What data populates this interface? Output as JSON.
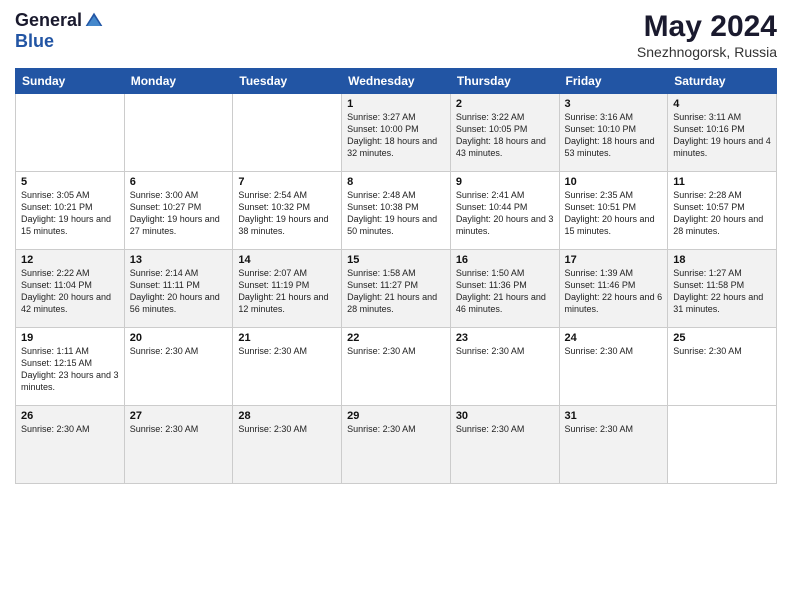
{
  "header": {
    "logo_general": "General",
    "logo_blue": "Blue",
    "month_year": "May 2024",
    "location": "Snezhnogorsk, Russia"
  },
  "days_of_week": [
    "Sunday",
    "Monday",
    "Tuesday",
    "Wednesday",
    "Thursday",
    "Friday",
    "Saturday"
  ],
  "weeks": [
    [
      {
        "day": "",
        "info": ""
      },
      {
        "day": "",
        "info": ""
      },
      {
        "day": "",
        "info": ""
      },
      {
        "day": "1",
        "info": "Sunrise: 3:27 AM\nSunset: 10:00 PM\nDaylight: 18 hours and 32 minutes."
      },
      {
        "day": "2",
        "info": "Sunrise: 3:22 AM\nSunset: 10:05 PM\nDaylight: 18 hours and 43 minutes."
      },
      {
        "day": "3",
        "info": "Sunrise: 3:16 AM\nSunset: 10:10 PM\nDaylight: 18 hours and 53 minutes."
      },
      {
        "day": "4",
        "info": "Sunrise: 3:11 AM\nSunset: 10:16 PM\nDaylight: 19 hours and 4 minutes."
      }
    ],
    [
      {
        "day": "5",
        "info": "Sunrise: 3:05 AM\nSunset: 10:21 PM\nDaylight: 19 hours and 15 minutes."
      },
      {
        "day": "6",
        "info": "Sunrise: 3:00 AM\nSunset: 10:27 PM\nDaylight: 19 hours and 27 minutes."
      },
      {
        "day": "7",
        "info": "Sunrise: 2:54 AM\nSunset: 10:32 PM\nDaylight: 19 hours and 38 minutes."
      },
      {
        "day": "8",
        "info": "Sunrise: 2:48 AM\nSunset: 10:38 PM\nDaylight: 19 hours and 50 minutes."
      },
      {
        "day": "9",
        "info": "Sunrise: 2:41 AM\nSunset: 10:44 PM\nDaylight: 20 hours and 3 minutes."
      },
      {
        "day": "10",
        "info": "Sunrise: 2:35 AM\nSunset: 10:51 PM\nDaylight: 20 hours and 15 minutes."
      },
      {
        "day": "11",
        "info": "Sunrise: 2:28 AM\nSunset: 10:57 PM\nDaylight: 20 hours and 28 minutes."
      }
    ],
    [
      {
        "day": "12",
        "info": "Sunrise: 2:22 AM\nSunset: 11:04 PM\nDaylight: 20 hours and 42 minutes."
      },
      {
        "day": "13",
        "info": "Sunrise: 2:14 AM\nSunset: 11:11 PM\nDaylight: 20 hours and 56 minutes."
      },
      {
        "day": "14",
        "info": "Sunrise: 2:07 AM\nSunset: 11:19 PM\nDaylight: 21 hours and 12 minutes."
      },
      {
        "day": "15",
        "info": "Sunrise: 1:58 AM\nSunset: 11:27 PM\nDaylight: 21 hours and 28 minutes."
      },
      {
        "day": "16",
        "info": "Sunrise: 1:50 AM\nSunset: 11:36 PM\nDaylight: 21 hours and 46 minutes."
      },
      {
        "day": "17",
        "info": "Sunrise: 1:39 AM\nSunset: 11:46 PM\nDaylight: 22 hours and 6 minutes."
      },
      {
        "day": "18",
        "info": "Sunrise: 1:27 AM\nSunset: 11:58 PM\nDaylight: 22 hours and 31 minutes."
      }
    ],
    [
      {
        "day": "19",
        "info": "Sunrise: 1:11 AM\nSunset: 12:15 AM\nDaylight: 23 hours and 3 minutes."
      },
      {
        "day": "20",
        "info": "Sunrise: 2:30 AM"
      },
      {
        "day": "21",
        "info": "Sunrise: 2:30 AM"
      },
      {
        "day": "22",
        "info": "Sunrise: 2:30 AM"
      },
      {
        "day": "23",
        "info": "Sunrise: 2:30 AM"
      },
      {
        "day": "24",
        "info": "Sunrise: 2:30 AM"
      },
      {
        "day": "25",
        "info": "Sunrise: 2:30 AM"
      }
    ],
    [
      {
        "day": "26",
        "info": "Sunrise: 2:30 AM"
      },
      {
        "day": "27",
        "info": "Sunrise: 2:30 AM"
      },
      {
        "day": "28",
        "info": "Sunrise: 2:30 AM"
      },
      {
        "day": "29",
        "info": "Sunrise: 2:30 AM"
      },
      {
        "day": "30",
        "info": "Sunrise: 2:30 AM"
      },
      {
        "day": "31",
        "info": "Sunrise: 2:30 AM"
      },
      {
        "day": "",
        "info": ""
      }
    ]
  ]
}
